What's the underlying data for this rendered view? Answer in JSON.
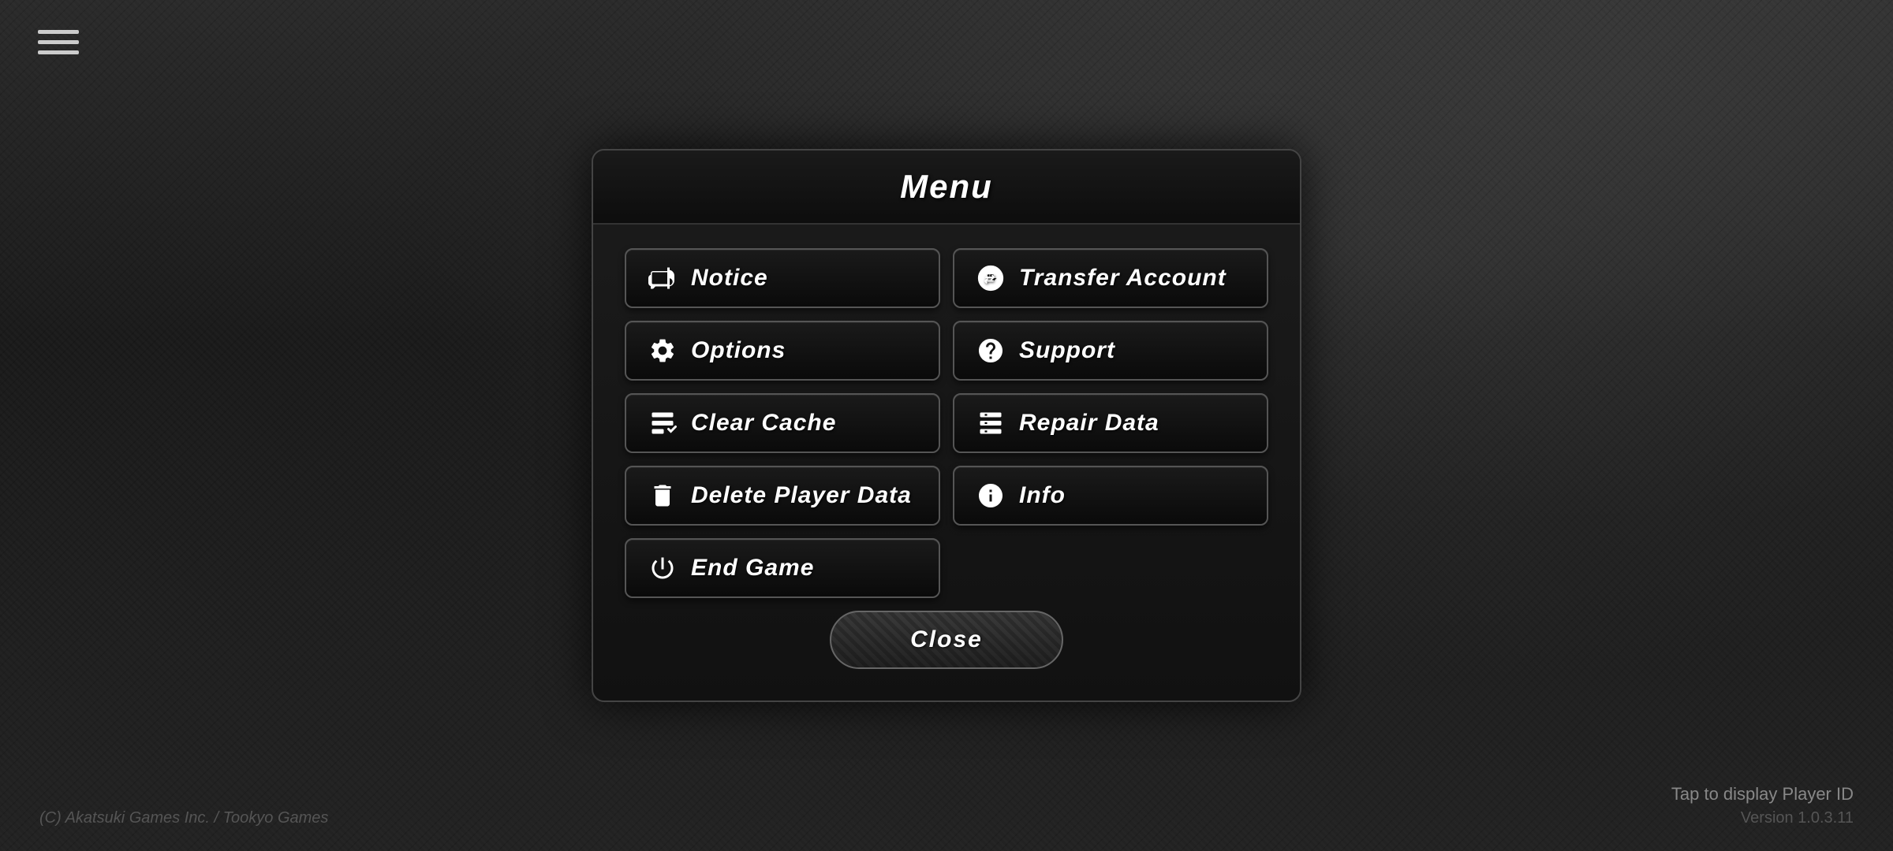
{
  "background": {
    "color": "#1a1a1a"
  },
  "hamburger": {
    "label": "menu-toggle"
  },
  "modal": {
    "title": "Menu",
    "buttons": {
      "left": [
        {
          "id": "notice",
          "label": "Notice",
          "icon": "megaphone"
        },
        {
          "id": "options",
          "label": "Options",
          "icon": "gear"
        },
        {
          "id": "clear-cache",
          "label": "Clear Cache",
          "icon": "clear-cache"
        },
        {
          "id": "delete-player-data",
          "label": "Delete Player Data",
          "icon": "trash"
        },
        {
          "id": "end-game",
          "label": "End Game",
          "icon": "power"
        }
      ],
      "right": [
        {
          "id": "transfer-account",
          "label": "Transfer Account",
          "icon": "transfer"
        },
        {
          "id": "support",
          "label": "Support",
          "icon": "question"
        },
        {
          "id": "repair-data",
          "label": "Repair Data",
          "icon": "repair"
        },
        {
          "id": "info",
          "label": "Info",
          "icon": "info"
        }
      ]
    },
    "close_label": "Close"
  },
  "footer": {
    "copyright": "(C) Akatsuki Games Inc. / Tookyo Games",
    "tap_player_id": "Tap to display Player ID",
    "version": "Version 1.0.3.11"
  }
}
